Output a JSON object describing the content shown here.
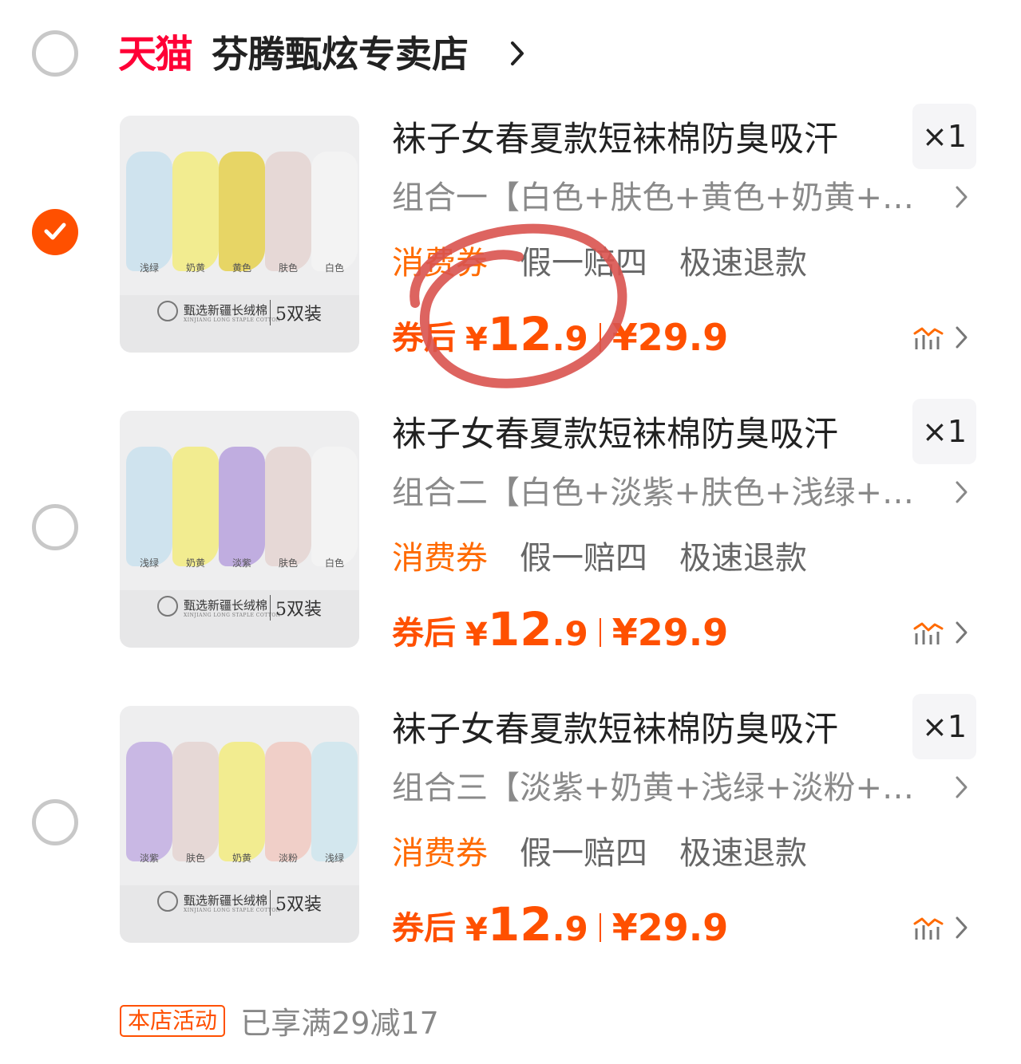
{
  "store": {
    "logo_text": "天猫",
    "name": "芬腾甄炫专卖店",
    "selected": false
  },
  "items": [
    {
      "selected": true,
      "title": "袜子女春夏款短袜棉防臭吸汗",
      "quantity": "×1",
      "sku": "组合一【白色+肤色+黄色+奶黄+…",
      "tags": [
        "消费券",
        "假一赔四",
        "极速退款"
      ],
      "price_label": "券后",
      "currency": "¥",
      "price_int": "12",
      "price_dec": ".9",
      "original_price": "¥29.9",
      "thumb": {
        "socks": [
          {
            "label": "浅绿",
            "color": "#cfe3ee"
          },
          {
            "label": "奶黄",
            "color": "#f2ec90"
          },
          {
            "label": "黄色",
            "color": "#e7d565"
          },
          {
            "label": "肤色",
            "color": "#e6d8d6"
          },
          {
            "label": "白色",
            "color": "#f3f3f3"
          }
        ],
        "band_text": "甄选新疆长绒棉",
        "band_sub": "XINJIANG LONG STAPLE COTTON",
        "pack": "5双装"
      }
    },
    {
      "selected": false,
      "title": "袜子女春夏款短袜棉防臭吸汗",
      "quantity": "×1",
      "sku": "组合二【白色+淡紫+肤色+浅绿+…",
      "tags": [
        "消费券",
        "假一赔四",
        "极速退款"
      ],
      "price_label": "券后",
      "currency": "¥",
      "price_int": "12",
      "price_dec": ".9",
      "original_price": "¥29.9",
      "thumb": {
        "socks": [
          {
            "label": "浅绿",
            "color": "#cfe3ee"
          },
          {
            "label": "奶黄",
            "color": "#f2ec90"
          },
          {
            "label": "淡紫",
            "color": "#c0ade0"
          },
          {
            "label": "肤色",
            "color": "#e6d8d6"
          },
          {
            "label": "白色",
            "color": "#f3f3f3"
          }
        ],
        "band_text": "甄选新疆长绒棉",
        "band_sub": "XINJIANG LONG STAPLE COTTON",
        "pack": "5双装"
      }
    },
    {
      "selected": false,
      "title": "袜子女春夏款短袜棉防臭吸汗",
      "quantity": "×1",
      "sku": "组合三【淡紫+奶黄+浅绿+淡粉+…",
      "tags": [
        "消费券",
        "假一赔四",
        "极速退款"
      ],
      "price_label": "券后",
      "currency": "¥",
      "price_int": "12",
      "price_dec": ".9",
      "original_price": "¥29.9",
      "thumb": {
        "socks": [
          {
            "label": "淡紫",
            "color": "#c9b8e4"
          },
          {
            "label": "肤色",
            "color": "#e6d8d6"
          },
          {
            "label": "奶黄",
            "color": "#f2ec90"
          },
          {
            "label": "淡粉",
            "color": "#f0cfc8"
          },
          {
            "label": "浅绿",
            "color": "#d3e7ee"
          }
        ],
        "band_text": "甄选新疆长绒棉",
        "band_sub": "XINJIANG LONG STAPLE COTTON",
        "pack": "5双装"
      }
    }
  ],
  "promo": {
    "badge": "本店活动",
    "text": "已享满29减17"
  },
  "colors": {
    "accent": "#ff5000",
    "tmall": "#ff0036",
    "coupon": "#ff6a00",
    "annotation": "#d9534f"
  }
}
